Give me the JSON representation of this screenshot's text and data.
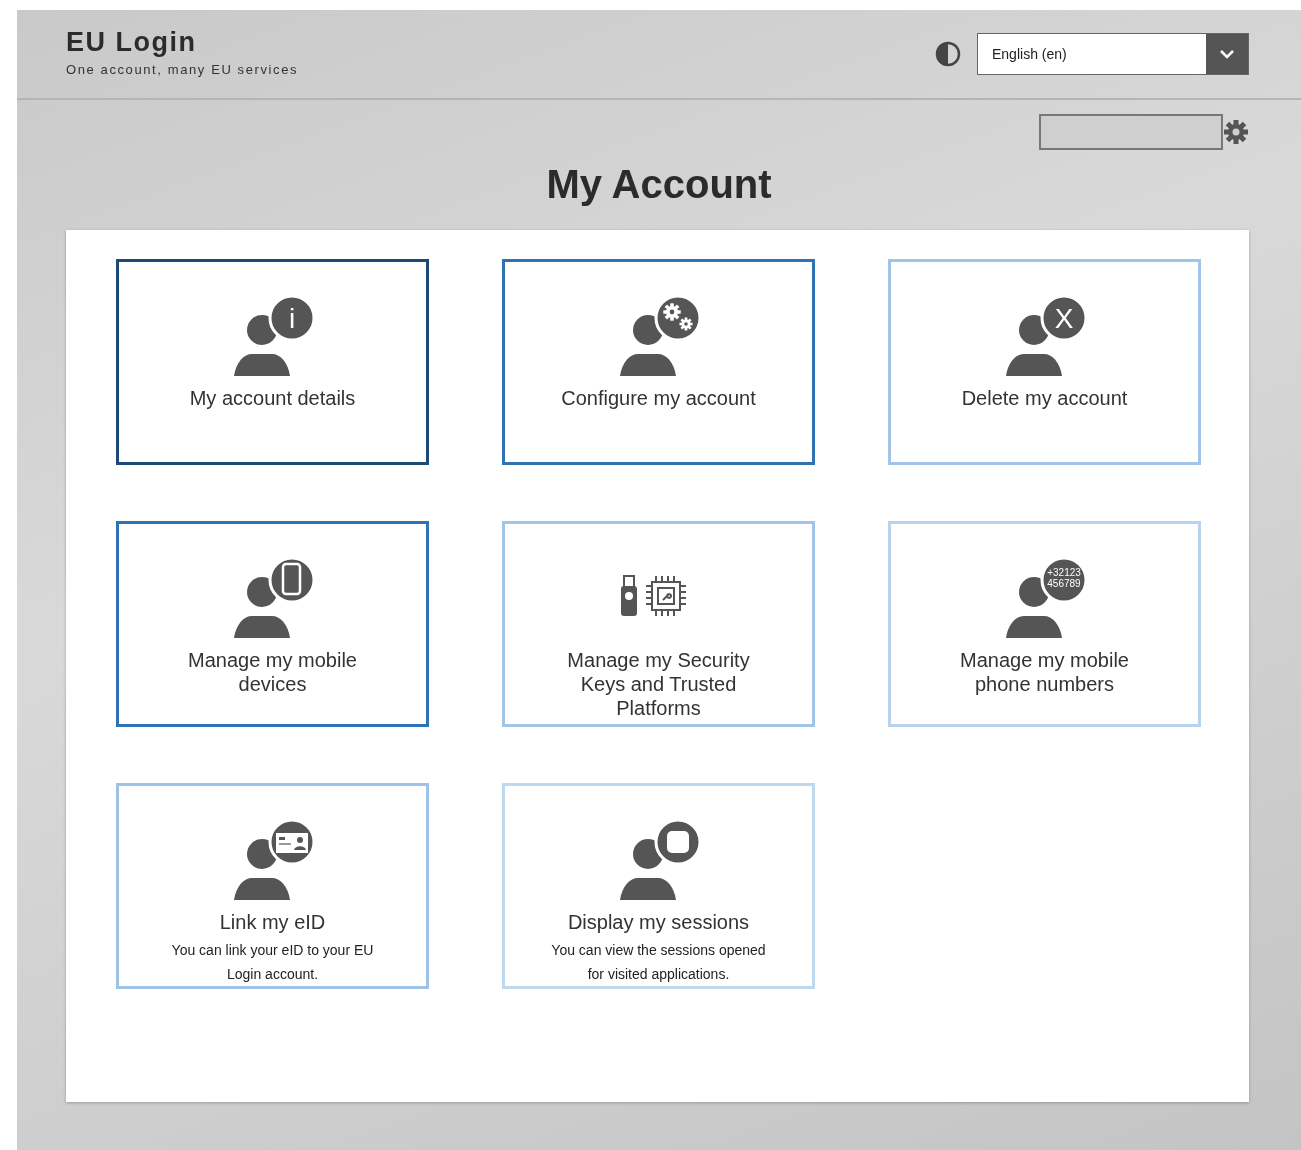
{
  "header": {
    "title": "EU Login",
    "subtitle": "One account, many EU services",
    "language": "English (en)"
  },
  "page_title": "My Account",
  "tiles": [
    {
      "label": "My account details",
      "kind": "info",
      "icon_text": "i",
      "color": "#1e4a77"
    },
    {
      "label": "Configure my account",
      "kind": "gears",
      "color": "#2f73b5"
    },
    {
      "label": "Delete my account",
      "kind": "cross",
      "icon_text": "X",
      "color": "#a2c4e8"
    },
    {
      "label": "Manage my mobile devices",
      "kind": "phone",
      "color": "#2f73b5"
    },
    {
      "label": "Manage my Security Keys and Trusted Platforms",
      "kind": "keys",
      "color": "#a2c4e8"
    },
    {
      "label": "Manage my mobile phone numbers",
      "kind": "numbers",
      "icon_text": "+32123 456789",
      "color": "#b8d3ee"
    },
    {
      "label": "Link my eID",
      "description": "You can link your eID to your EU Login account.",
      "kind": "eid",
      "color": "#9dc3e6"
    },
    {
      "label": "Display my sessions",
      "description": "You can view the sessions opened for visited applications.",
      "kind": "sessions",
      "color": "#bed8f0"
    }
  ]
}
